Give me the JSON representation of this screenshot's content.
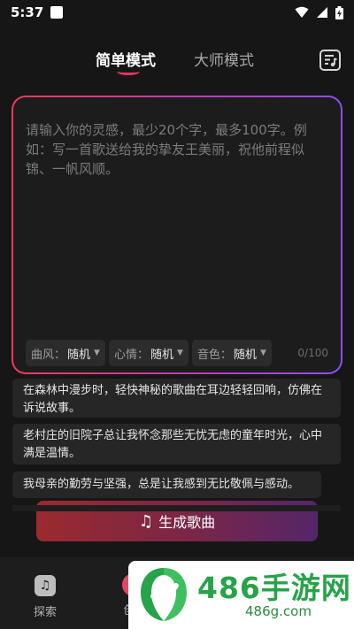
{
  "status": {
    "time": "5:37"
  },
  "tabs": [
    {
      "label": "简单模式",
      "active": true
    },
    {
      "label": "大师模式",
      "active": false
    }
  ],
  "prompt": {
    "placeholder": "请输入你的灵感，最少20个字，最多100字。例如：写一首歌送给我的挚友王美丽，祝他前程似锦、一帆风顺。",
    "char_count": "0/100"
  },
  "chips": [
    {
      "key": "曲风：",
      "value": "随机"
    },
    {
      "key": "心情：",
      "value": "随机"
    },
    {
      "key": "音色：",
      "value": "随机"
    }
  ],
  "suggestions": [
    "在森林中漫步时，轻快神秘的歌曲在耳边轻轻回响，仿佛在诉说故事。",
    " 老村庄的旧院子总让我怀念那些无忧无虑的童年时光，心中满是温情。",
    "我母亲的勤劳与坚强，总是让我感到无比敬佩与感动。"
  ],
  "generate_button": "生成歌曲",
  "bottom_nav": [
    {
      "label": "探索"
    },
    {
      "label": "创"
    }
  ],
  "watermark": {
    "title": "486手游网",
    "url": "486g.com"
  },
  "colors": {
    "accent_red": "#ee3a56",
    "accent_purple": "#8a4ef2",
    "background": "#161616",
    "watermark_green": "#27a34a"
  }
}
